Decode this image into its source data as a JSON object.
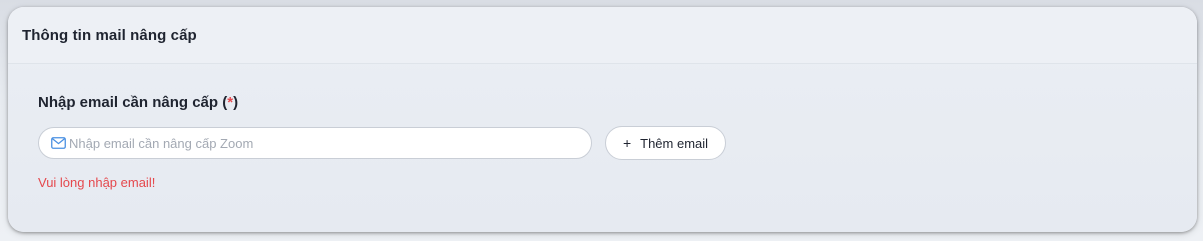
{
  "section": {
    "title": "Thông tin mail nâng cấp"
  },
  "email_field": {
    "label": "Nhập email cần nâng cấp",
    "required_open": "(",
    "required_mark": "*",
    "required_close": ")",
    "placeholder": "Nhập email cần nâng cấp Zoom",
    "value": "",
    "icon": "mail-icon",
    "error": "Vui lòng nhập email!"
  },
  "add_email_button": {
    "icon": "plus-icon",
    "icon_glyph": "+",
    "label": "Thêm email"
  },
  "colors": {
    "error": "#e5484d",
    "icon_accent": "#4a90e2",
    "text": "#1f2430"
  }
}
